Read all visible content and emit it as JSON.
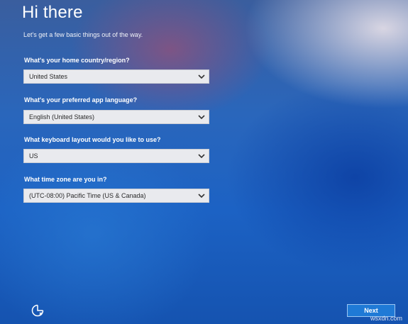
{
  "header": {
    "title": "Hi there",
    "subtitle": "Let's get a few basic things out of the way."
  },
  "fields": [
    {
      "label": "What's your home country/region?",
      "value": "United States"
    },
    {
      "label": "What's your preferred app language?",
      "value": "English (United States)"
    },
    {
      "label": "What keyboard layout would you like to use?",
      "value": "US"
    },
    {
      "label": "What time zone are you in?",
      "value": "(UTC-08:00) Pacific Time (US & Canada)"
    }
  ],
  "footer": {
    "next_label": "Next",
    "cortana_icon": "cortana-icon"
  },
  "watermark": "wsxdn.com",
  "colors": {
    "background": "#1b5fb8",
    "dropdown_bg": "#e9eaee",
    "next_button": "#1f7ad6"
  }
}
